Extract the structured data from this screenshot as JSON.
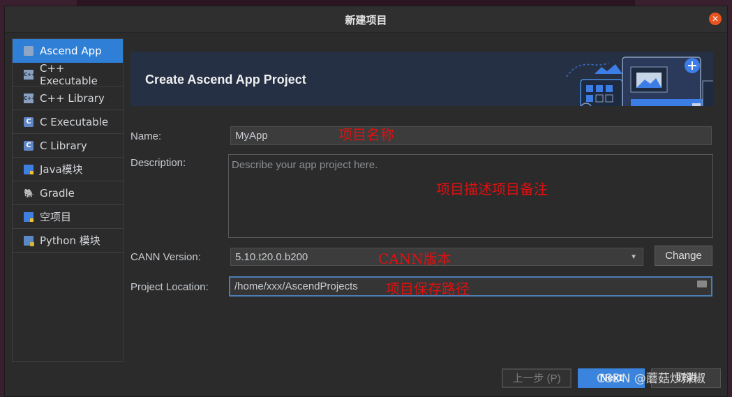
{
  "window": {
    "title": "新建项目"
  },
  "sidebar": {
    "items": [
      {
        "label": "Ascend App",
        "icon": "ascend-app-icon",
        "selected": true
      },
      {
        "label": "C++ Executable",
        "icon": "cpp-icon"
      },
      {
        "label": "C++ Library",
        "icon": "cpp-icon"
      },
      {
        "label": "C Executable",
        "icon": "c-icon"
      },
      {
        "label": "C Library",
        "icon": "c-icon"
      },
      {
        "label": "Java模块",
        "icon": "folder-icon"
      },
      {
        "label": "Gradle",
        "icon": "gradle-icon"
      },
      {
        "label": "空项目",
        "icon": "folder-icon"
      },
      {
        "label": "Python 模块",
        "icon": "python-folder-icon"
      }
    ]
  },
  "banner": {
    "title": "Create Ascend App Project"
  },
  "form": {
    "name_label": "Name:",
    "name_value": "MyApp",
    "description_label": "Description:",
    "description_placeholder": "Describe your app project here.",
    "cann_label": "CANN Version:",
    "cann_value": "5.10.t20.0.b200",
    "change_label": "Change",
    "location_label": "Project Location:",
    "location_value": "/home/xxx/AscendProjects"
  },
  "annotations": {
    "name": "项目名称",
    "description": "项目描述项目备注",
    "cann": "CANN版本",
    "location": "项目保存路径"
  },
  "buttons": {
    "prev": "上一步 (P)",
    "next": "Next",
    "cancel": "取消"
  },
  "watermark": "CSDN @蘑菇炒辣椒",
  "colors": {
    "accent": "#3a84dd",
    "annotation": "#e01010",
    "close": "#e95420"
  }
}
